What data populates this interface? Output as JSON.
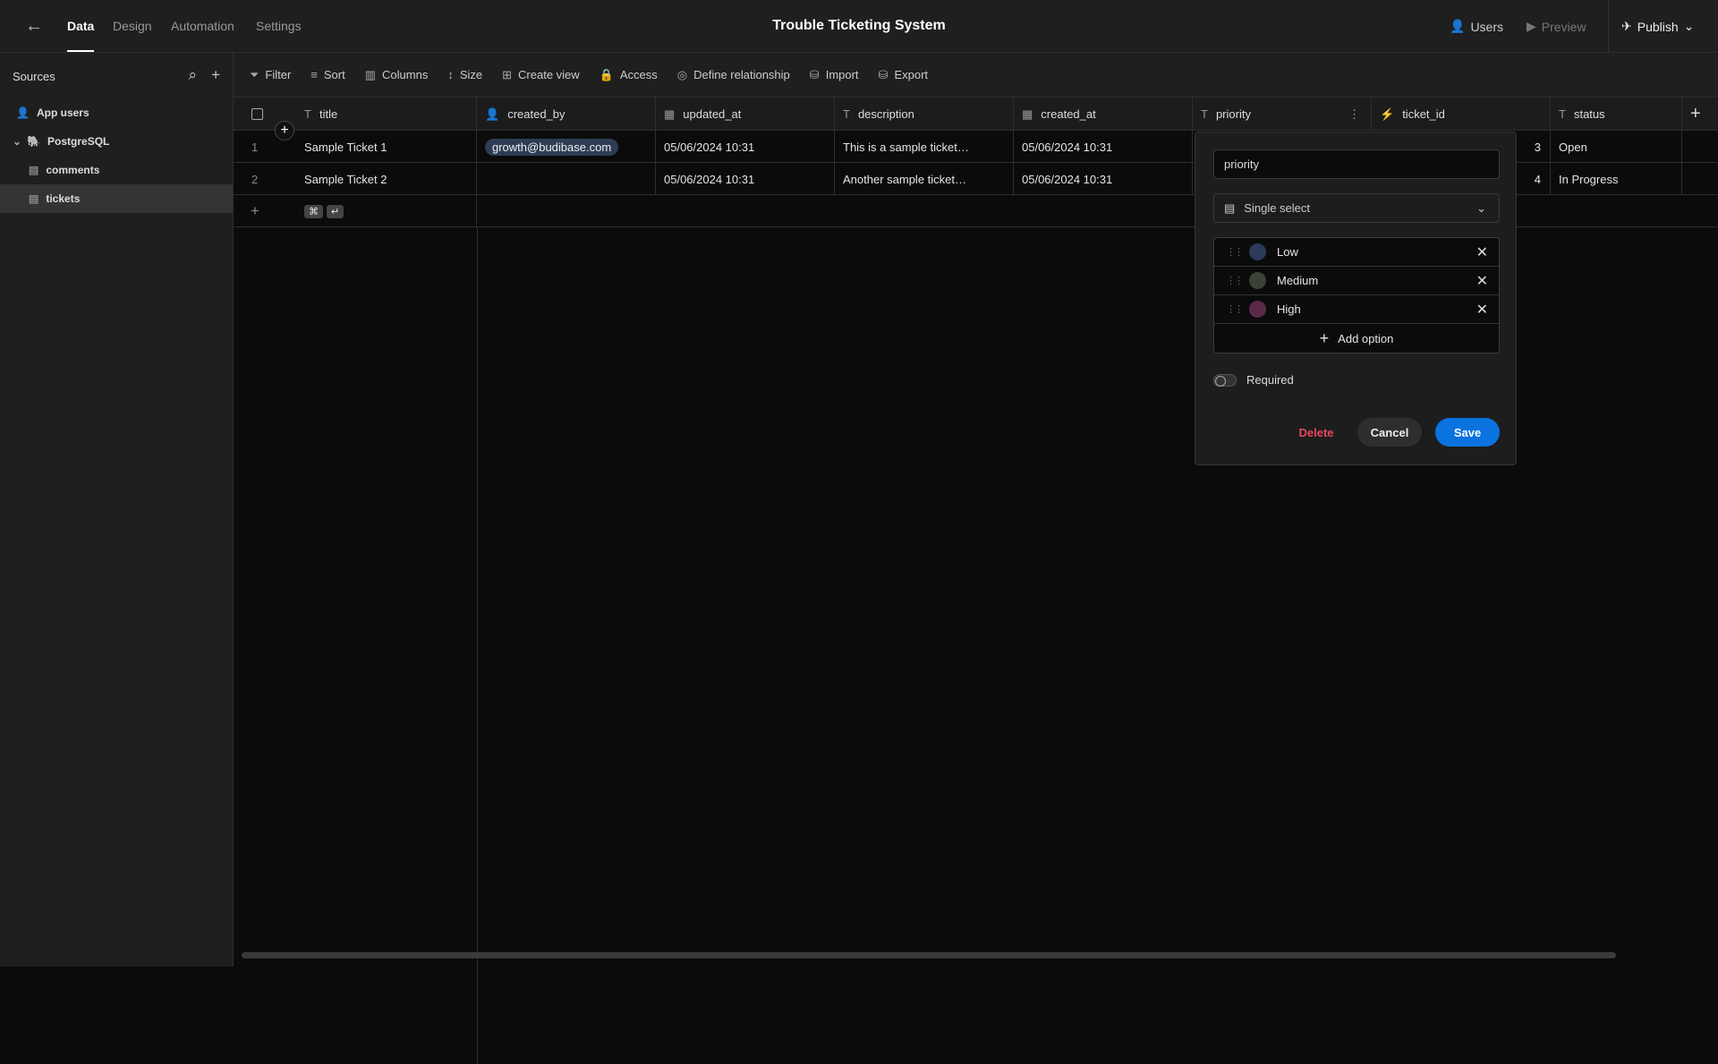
{
  "topbar": {
    "tabs": [
      "Data",
      "Design",
      "Automation",
      "Settings"
    ],
    "title": "Trouble Ticketing System",
    "users": "Users",
    "preview": "Preview",
    "publish": "Publish"
  },
  "sidebar": {
    "header": "Sources",
    "items": [
      {
        "label": "App users"
      },
      {
        "label": "PostgreSQL"
      },
      {
        "label": "comments"
      },
      {
        "label": "tickets"
      }
    ]
  },
  "toolbar": {
    "items": [
      "Filter",
      "Sort",
      "Columns",
      "Size",
      "Create view",
      "Access",
      "Define relationship",
      "Import",
      "Export"
    ]
  },
  "table": {
    "columns": [
      "title",
      "created_by",
      "updated_at",
      "description",
      "created_at",
      "priority",
      "ticket_id",
      "status"
    ],
    "rows": [
      {
        "num": "1",
        "title": "Sample Ticket 1",
        "created_by": "growth@budibase.com",
        "updated_at": "05/06/2024 10:31",
        "description": "This is a sample ticket…",
        "created_at": "05/06/2024 10:31",
        "ticket_id": "3",
        "status": "Open"
      },
      {
        "num": "2",
        "title": "Sample Ticket 2",
        "created_by": "",
        "updated_at": "05/06/2024 10:31",
        "description": "Another sample ticket…",
        "created_at": "05/06/2024 10:31",
        "ticket_id": "4",
        "status": "In Progress"
      }
    ],
    "shortcut_keys": [
      "⌘",
      "↵"
    ]
  },
  "popup": {
    "name_value": "priority",
    "type": "Single select",
    "options": [
      {
        "label": "Low",
        "color": "#2c3a59"
      },
      {
        "label": "Medium",
        "color": "#3a4236"
      },
      {
        "label": "High",
        "color": "#5a2a48"
      }
    ],
    "add_option": "Add option",
    "required": "Required",
    "required_on": false,
    "delete": "Delete",
    "cancel": "Cancel",
    "save": "Save"
  }
}
